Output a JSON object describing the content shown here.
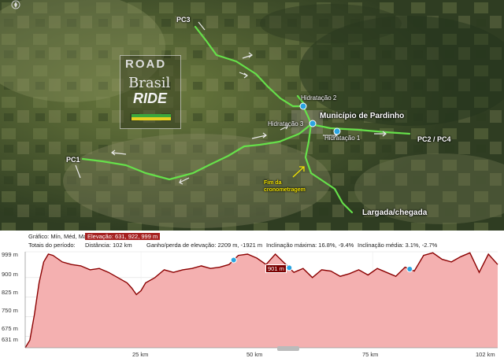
{
  "map": {
    "labels": {
      "pc3": "PC3",
      "pc1": "PC1",
      "pc2pc4": "PC2 / PC4",
      "municipio": "Município de Pardinho",
      "hidratacao1": "Hidratação 1",
      "hidratacao2": "Hidratação 2",
      "hidratacao3": "Hidratação 3",
      "fim_line1": "Fim da",
      "fim_line2": "cronometragem",
      "largada": "Largada/chegada"
    },
    "logo": {
      "road": "ROAD",
      "brasil": "Brasil",
      "ride": "RIDE"
    },
    "compass_icon": "compass-icon",
    "route_color": "#66e04a"
  },
  "profile": {
    "info": {
      "grafico_label": "Gráfico: Mín, Méd, Max",
      "elevacao": "Elevação: 631, 922, 999 m",
      "totais_label": "Totais do período:",
      "distancia": "Distância: 102 km",
      "ganho": "Ganho/perda de elevação: 2209 m, -1921 m",
      "inclinacao_max": "Inclinação máxima: 16.8%, -9.4%",
      "inclinacao_media": "Inclinação média: 3.1%, -2.7%"
    },
    "y_ticks": [
      "999 m",
      "900 m",
      "825 m",
      "750 m",
      "675 m",
      "631 m"
    ],
    "x_ticks": [
      "25 km",
      "50 km",
      "75 km",
      "102 km"
    ],
    "callout": "901 m",
    "line_color": "#8b0000",
    "fill_color": "#f4b0b0"
  },
  "chart_data": {
    "type": "area",
    "title": "",
    "xlabel": "",
    "ylabel": "",
    "xlim": [
      0,
      102
    ],
    "ylim": [
      631,
      999
    ],
    "x_unit": "km",
    "y_unit": "m",
    "x": [
      0,
      1,
      2,
      3,
      4,
      5,
      6,
      8,
      10,
      12,
      14,
      16,
      18,
      20,
      22,
      23,
      24,
      25,
      26,
      28,
      30,
      32,
      34,
      36,
      38,
      40,
      42,
      44,
      46,
      48,
      50,
      52,
      54,
      56,
      58,
      60,
      62,
      64,
      66,
      68,
      70,
      72,
      74,
      76,
      78,
      80,
      82,
      84,
      86,
      88,
      90,
      92,
      94,
      96,
      98,
      100,
      102
    ],
    "y": [
      631,
      660,
      760,
      880,
      960,
      990,
      985,
      960,
      950,
      945,
      930,
      935,
      920,
      900,
      880,
      860,
      835,
      850,
      880,
      900,
      930,
      920,
      930,
      935,
      945,
      935,
      940,
      950,
      985,
      990,
      975,
      950,
      990,
      955,
      920,
      935,
      900,
      930,
      925,
      905,
      915,
      930,
      910,
      935,
      920,
      905,
      940,
      925,
      985,
      995,
      970,
      960,
      980,
      995,
      920,
      990,
      950
    ],
    "markers_x_km": [
      45,
      57,
      83
    ],
    "markers": [
      "Hidratação 1",
      "Hidratação 2",
      "Hidratação 3"
    ]
  }
}
